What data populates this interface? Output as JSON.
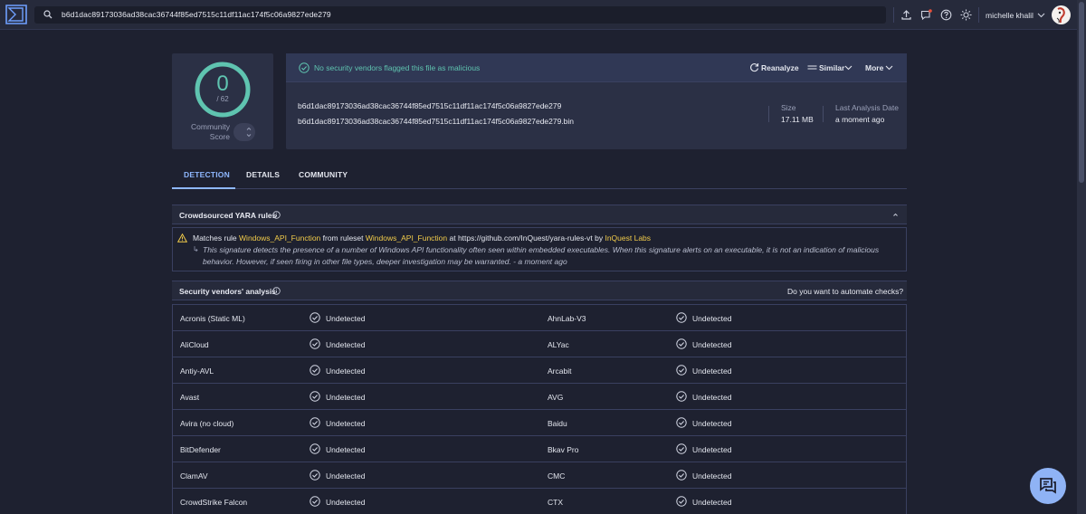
{
  "search": {
    "value": "b6d1dac89173036ad38cac36744f85ed7515c11df11ac174f5c06a9827ede279"
  },
  "user": {
    "name": "michelle khalil"
  },
  "score": {
    "detections": "0",
    "total": "/ 62",
    "community_label_1": "Community",
    "community_label_2": "Score"
  },
  "summary": {
    "status": "No security vendors flagged this file as malicious",
    "actions": {
      "reanalyze": "Reanalyze",
      "similar": "Similar",
      "more": "More"
    },
    "hash": "b6d1dac89173036ad38cac36744f85ed7515c11df11ac174f5c06a9827ede279",
    "filename": "b6d1dac89173036ad38cac36744f85ed7515c11df11ac174f5c06a9827ede279.bin",
    "size_label": "Size",
    "size_value": "17.11 MB",
    "last_label": "Last Analysis Date",
    "last_value": "a moment ago"
  },
  "tabs": [
    "DETECTION",
    "DETAILS",
    "COMMUNITY"
  ],
  "yara": {
    "title": "Crowdsourced YARA rules",
    "p1": "Matches rule ",
    "rule": "Windows_API_Function",
    "p2": " from ruleset ",
    "ruleset": "Windows_API_Function",
    "p3": " at https://github.com/InQuest/yara-rules-vt by ",
    "author": "InQuest Labs",
    "desc": "This signature detects the presence of a number of Windows API functionality often seen within embedded executables. When this signature alerts on an executable, it is not an indication of malicious behavior. However, if seen firing in other file types, deeper investigation may be warranted. - a moment ago"
  },
  "vendors_section": {
    "title": "Security vendors' analysis",
    "automate": "Do you want to automate checks?"
  },
  "vendors": [
    {
      "left": "Acronis (Static ML)",
      "left_result": "Undetected",
      "right": "AhnLab-V3",
      "right_result": "Undetected"
    },
    {
      "left": "AliCloud",
      "left_result": "Undetected",
      "right": "ALYac",
      "right_result": "Undetected"
    },
    {
      "left": "Antiy-AVL",
      "left_result": "Undetected",
      "right": "Arcabit",
      "right_result": "Undetected"
    },
    {
      "left": "Avast",
      "left_result": "Undetected",
      "right": "AVG",
      "right_result": "Undetected"
    },
    {
      "left": "Avira (no cloud)",
      "left_result": "Undetected",
      "right": "Baidu",
      "right_result": "Undetected"
    },
    {
      "left": "BitDefender",
      "left_result": "Undetected",
      "right": "Bkav Pro",
      "right_result": "Undetected"
    },
    {
      "left": "ClamAV",
      "left_result": "Undetected",
      "right": "CMC",
      "right_result": "Undetected"
    },
    {
      "left": "CrowdStrike Falcon",
      "left_result": "Undetected",
      "right": "CTX",
      "right_result": "Undetected"
    }
  ],
  "colors": {
    "accent": "#8fb8ff",
    "clean": "#5fc4b0",
    "highlight": "#f2cc4a"
  }
}
